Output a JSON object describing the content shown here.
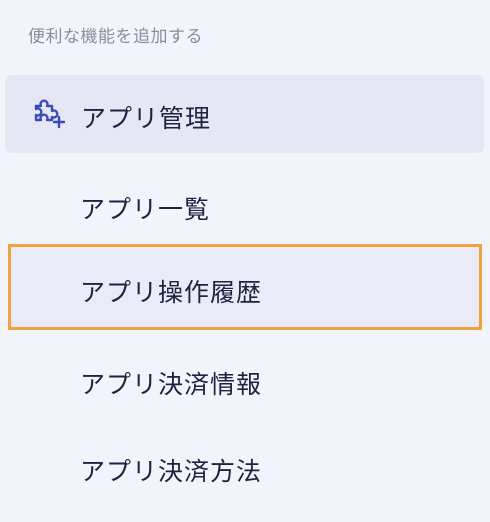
{
  "sidebar": {
    "section_caption": "便利な機能を追加する",
    "parent": {
      "label": "アプリ管理",
      "icon": "puzzle-plus-icon"
    },
    "items": [
      {
        "label": "アプリ一覧",
        "selected": false
      },
      {
        "label": "アプリ操作履歴",
        "selected": true
      },
      {
        "label": "アプリ決済情報",
        "selected": false
      },
      {
        "label": "アプリ決済方法",
        "selected": false
      }
    ]
  },
  "colors": {
    "background": "#f2f4fc",
    "parent_background": "#e5e8f4",
    "selected_border": "#f0a23c",
    "icon": "#3b4bb5",
    "text": "#1f2240",
    "caption": "#8a8d9e"
  }
}
